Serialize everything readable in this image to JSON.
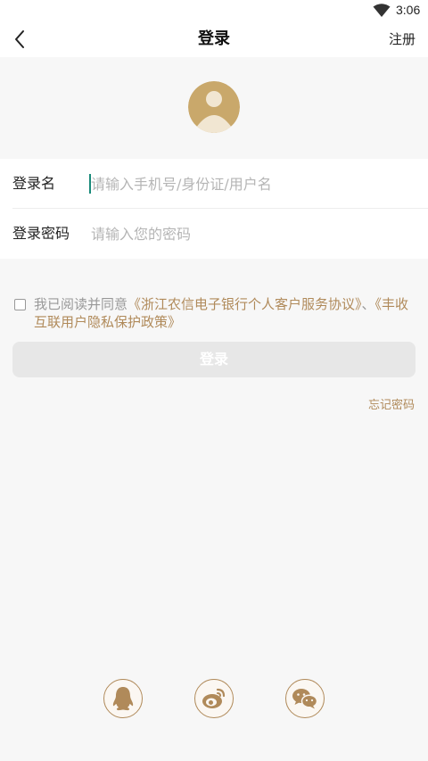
{
  "status_bar": {
    "time": "3:06"
  },
  "header": {
    "title": "登录",
    "register_label": "注册"
  },
  "form": {
    "username_label": "登录名",
    "username_placeholder": "请输入手机号/身份证/用户名",
    "password_label": "登录密码",
    "password_placeholder": "请输入您的密码"
  },
  "agreement": {
    "prefix": "我已阅读并同意",
    "link1": "《浙江农信电子银行个人客户服务协议》",
    "separator": "、",
    "link2": "《丰收互联用户隐私保护政策》"
  },
  "login_button": "登录",
  "forgot_password": "忘记密码",
  "social_logins": [
    "qq-icon",
    "weibo-icon",
    "wechat-icon"
  ],
  "colors": {
    "accent": "#b08a5a",
    "avatar": "#c9a86b",
    "button_disabled": "#e7e7e7",
    "caret": "#1a8a7a"
  }
}
